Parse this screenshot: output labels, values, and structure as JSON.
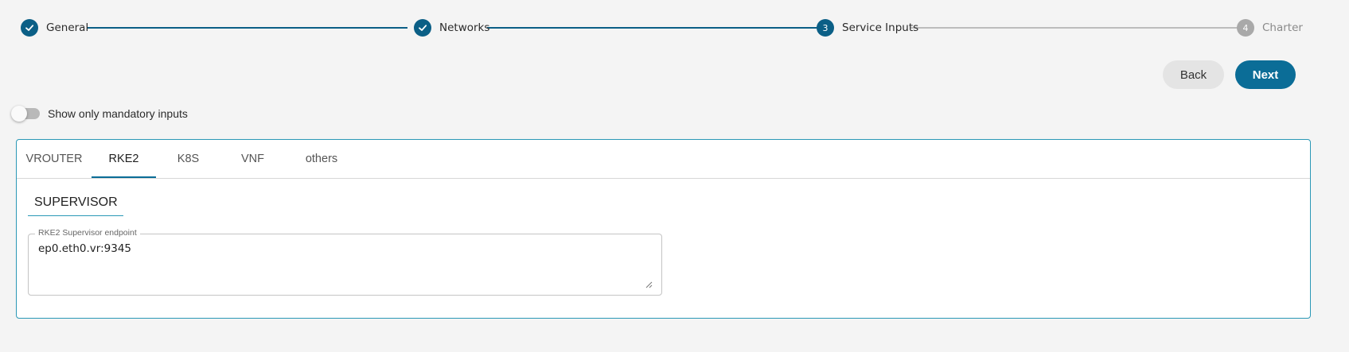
{
  "stepper": {
    "steps": [
      {
        "label": "General",
        "state": "done"
      },
      {
        "label": "Networks",
        "state": "done"
      },
      {
        "label": "Service Inputs",
        "state": "active",
        "number": "3"
      },
      {
        "label": "Charter",
        "state": "pending",
        "number": "4"
      }
    ]
  },
  "actions": {
    "back_label": "Back",
    "next_label": "Next"
  },
  "toggle": {
    "label": "Show only mandatory inputs",
    "checked": false
  },
  "tabs": [
    {
      "label": "VROUTER",
      "active": false
    },
    {
      "label": "RKE2",
      "active": true
    },
    {
      "label": "K8S",
      "active": false
    },
    {
      "label": "VNF",
      "active": false
    },
    {
      "label": "others",
      "active": false
    }
  ],
  "section": {
    "title": "SUPERVISOR",
    "field": {
      "label": "RKE2 Supervisor endpoint",
      "value": "ep0.eth0.vr:9345"
    }
  },
  "colors": {
    "accent": "#0b5f86",
    "button_primary": "#0b6d97",
    "panel_border": "#2a98b6",
    "pending": "#a9a9a9"
  },
  "icons": {
    "done_step": "check-icon",
    "textarea_resize": "resize-grip-icon"
  }
}
